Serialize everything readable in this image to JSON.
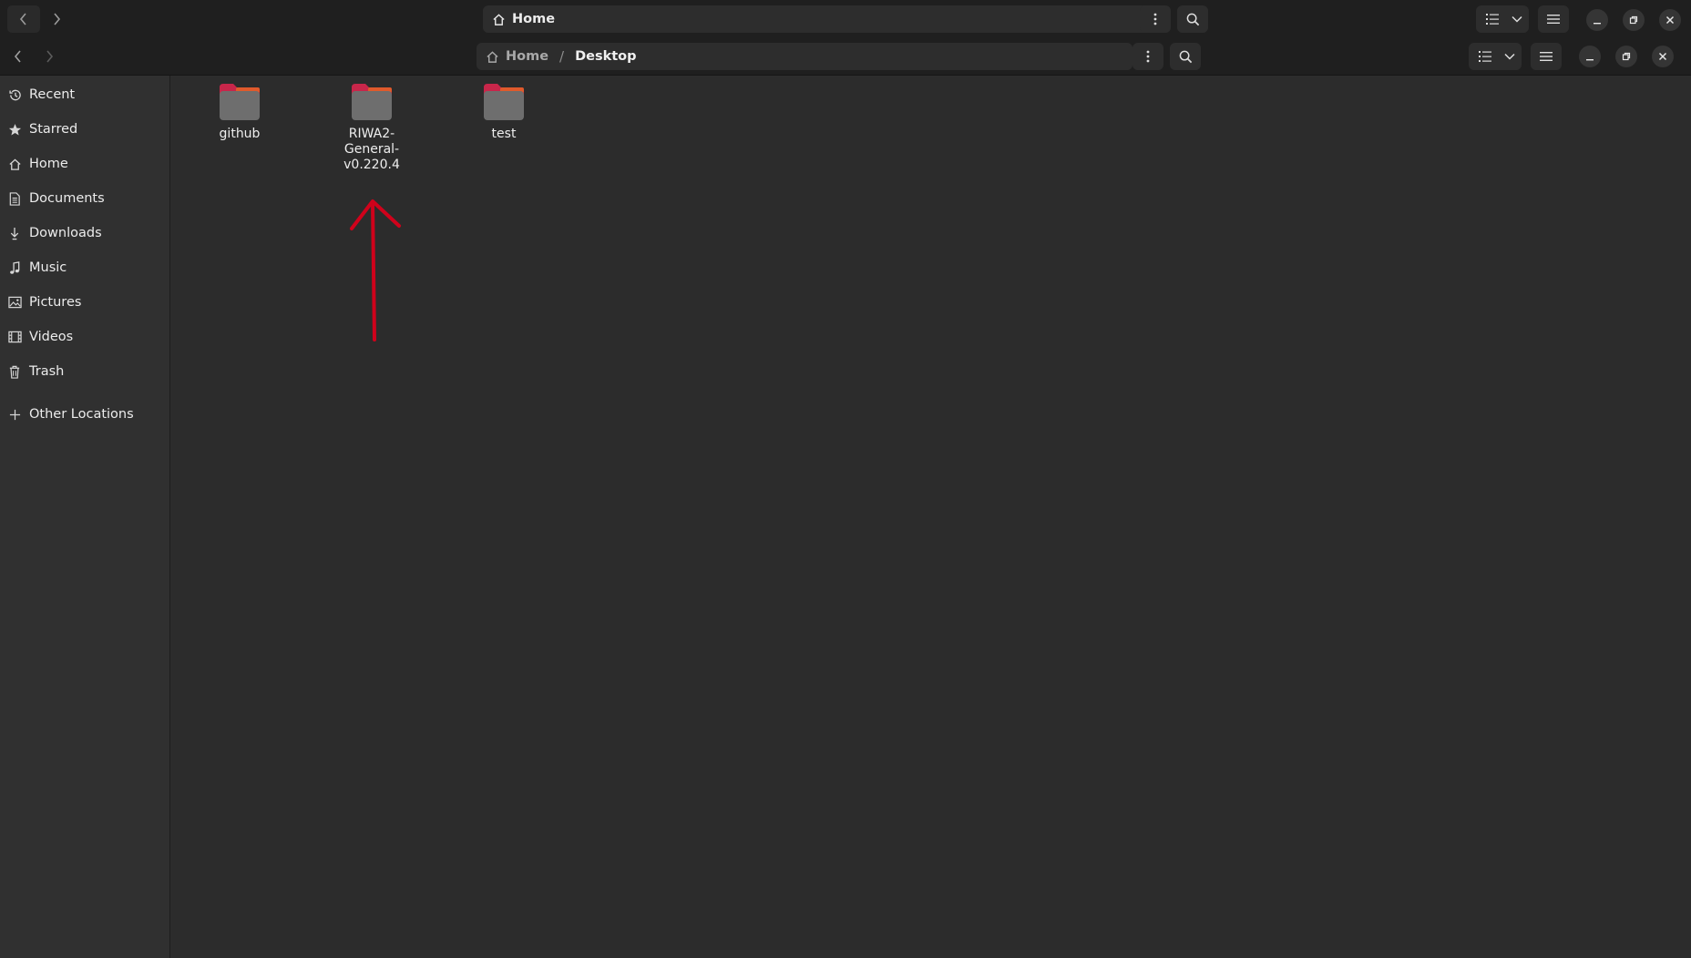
{
  "window_back": {
    "title": "Home"
  },
  "window_front": {
    "breadcrumb": {
      "home": "Home",
      "separator": "/",
      "current": "Desktop"
    }
  },
  "sidebar": {
    "items": [
      {
        "label": "Recent",
        "icon": "clock-icon"
      },
      {
        "label": "Starred",
        "icon": "star-icon"
      },
      {
        "label": "Home",
        "icon": "home-icon"
      },
      {
        "label": "Documents",
        "icon": "document-icon"
      },
      {
        "label": "Downloads",
        "icon": "download-icon"
      },
      {
        "label": "Music",
        "icon": "music-icon"
      },
      {
        "label": "Pictures",
        "icon": "picture-icon"
      },
      {
        "label": "Videos",
        "icon": "video-icon"
      },
      {
        "label": "Trash",
        "icon": "trash-icon"
      },
      {
        "label": "Other Locations",
        "icon": "plus-icon"
      }
    ]
  },
  "files": [
    {
      "name": "github",
      "type": "folder"
    },
    {
      "name": "RIWA2-General-v0.220.4",
      "type": "folder"
    },
    {
      "name": "test",
      "type": "folder"
    }
  ],
  "annotation": {
    "type": "arrow",
    "color": "#d0021b",
    "points_to": "RIWA2-General-v0.220.4"
  },
  "colors": {
    "folder_body": "#6e6e6e",
    "folder_tab": "#c8264a",
    "folder_tab_accent": "#e05a2c",
    "window_background": "#2c2c2c",
    "sidebar_background": "#303030",
    "header_background": "#1f1f1f"
  }
}
